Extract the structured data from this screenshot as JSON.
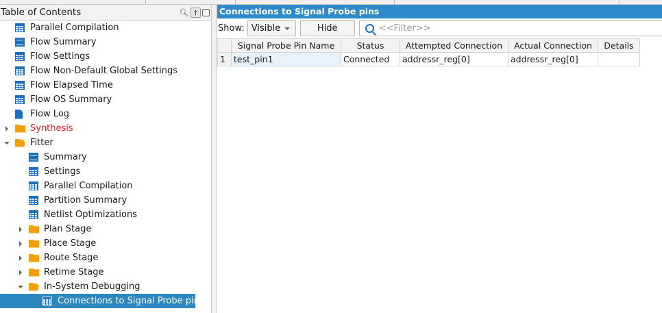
{
  "toc": {
    "title": "Table of Contents",
    "items": [
      {
        "label": "Parallel Compilation",
        "icon": "table",
        "level": 0
      },
      {
        "label": "Flow Summary",
        "icon": "list",
        "level": 0
      },
      {
        "label": "Flow Settings",
        "icon": "table",
        "level": 0
      },
      {
        "label": "Flow Non-Default Global Settings",
        "icon": "table",
        "level": 0
      },
      {
        "label": "Flow Elapsed Time",
        "icon": "table",
        "level": 0
      },
      {
        "label": "Flow OS Summary",
        "icon": "table",
        "level": 0
      },
      {
        "label": "Flow Log",
        "icon": "doc",
        "level": 0
      },
      {
        "label": "Synthesis",
        "icon": "folder",
        "level": 0,
        "arrow": "r",
        "color": "#e02020"
      },
      {
        "label": "Fitter",
        "icon": "folder-open",
        "level": 0,
        "arrow": "d"
      },
      {
        "label": "Summary",
        "icon": "list",
        "level": 1
      },
      {
        "label": "Settings",
        "icon": "table",
        "level": 1
      },
      {
        "label": "Parallel Compilation",
        "icon": "table",
        "level": 1
      },
      {
        "label": "Partition Summary",
        "icon": "table",
        "level": 1
      },
      {
        "label": "Netlist Optimizations",
        "icon": "table",
        "level": 1
      },
      {
        "label": "Plan Stage",
        "icon": "folder",
        "level": 1,
        "arrow": "r"
      },
      {
        "label": "Place Stage",
        "icon": "folder",
        "level": 1,
        "arrow": "r"
      },
      {
        "label": "Route Stage",
        "icon": "folder",
        "level": 1,
        "arrow": "r"
      },
      {
        "label": "Retime Stage",
        "icon": "folder",
        "level": 1,
        "arrow": "r"
      },
      {
        "label": "In-System Debugging",
        "icon": "folder-open",
        "level": 1,
        "arrow": "d"
      },
      {
        "label": "Connections to Signal Probe pins",
        "icon": "table",
        "level": 2,
        "selected": true
      }
    ]
  },
  "panel": {
    "title": "Connections to Signal Probe pins",
    "show_label": "Show:",
    "show_value": "Visible",
    "hide_label": "Hide",
    "filter_placeholder": "<<Filter>>",
    "columns": [
      "Signal Probe Pin Name",
      "Status",
      "Attempted Connection",
      "Actual Connection",
      "Details"
    ],
    "rows": [
      {
        "num": "1",
        "cells": [
          "test_pin1",
          "Connected",
          "addressr_reg[0]",
          "addressr_reg[0]",
          ""
        ]
      }
    ]
  }
}
